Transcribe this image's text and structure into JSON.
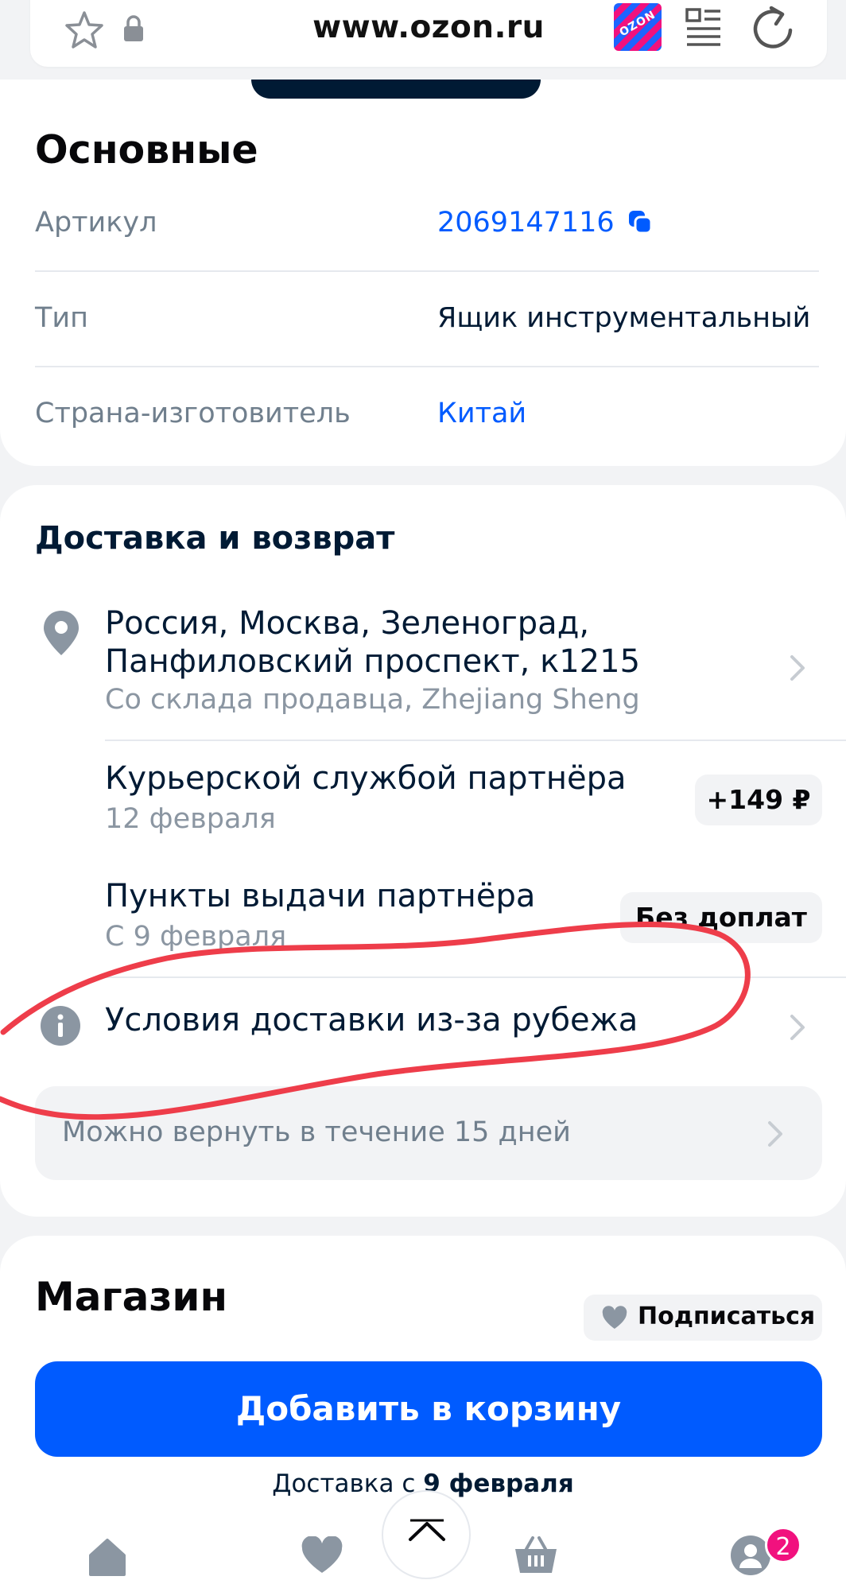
{
  "browser": {
    "url": "www.ozon.ru",
    "logo_text": "OZON"
  },
  "specs": {
    "title": "Основные",
    "rows": [
      {
        "key": "Артикул",
        "value": "2069147116"
      },
      {
        "key": "Тип",
        "value": "Ящик инструментальный"
      },
      {
        "key": "Страна-изготовитель",
        "value": "Китай"
      }
    ]
  },
  "delivery": {
    "title": "Доставка и возврат",
    "address_line1": "Россия, Москва, Зеленоград,",
    "address_line2": "Панфиловский проспект, к1215",
    "address_sub": "Со склада продавца, Zhejiang Sheng",
    "options": [
      {
        "title": "Курьерской службой партнёра",
        "date": "12 февраля",
        "price": "+149 ₽"
      },
      {
        "title": "Пункты выдачи партнёра",
        "date": "С 9 февраля",
        "price": "Без доплат"
      }
    ],
    "conditions": "Условия доставки из-за рубежа",
    "return_text": "Можно вернуть в течение 15 дней"
  },
  "shop": {
    "title": "Магазин",
    "subscribe": "Подписаться",
    "add_to_cart": "Добавить в корзину",
    "delivery_prefix": "Доставка с",
    "delivery_date": "9 февраля"
  },
  "nav": {
    "badge": "2"
  },
  "colors": {
    "accent": "#005bff",
    "brand_pink": "#f1117e",
    "annotation": "#ee3d4a"
  }
}
